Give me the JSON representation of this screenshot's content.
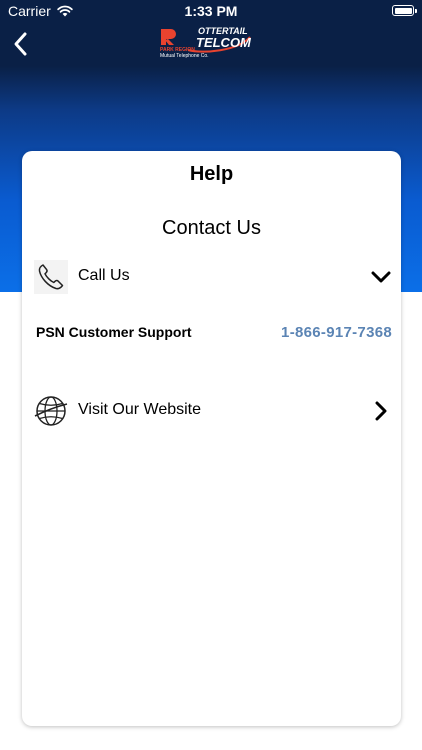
{
  "status_bar": {
    "carrier": "Carrier",
    "time": "1:33 PM"
  },
  "nav": {
    "back_icon": "chevron-left-icon",
    "logo": {
      "line1": "OTTERTAIL",
      "line2": "TELCOM",
      "line3": "PARK REGION",
      "line4": "Mutual Telephone Co."
    }
  },
  "card": {
    "title": "Help",
    "section_title": "Contact Us",
    "call_row": {
      "label": "Call Us",
      "icon": "phone-icon",
      "chevron": "chevron-down-icon"
    },
    "support": {
      "name": "PSN Customer Support",
      "phone": "1-866-917-7368"
    },
    "website_row": {
      "label": "Visit Our Website",
      "icon": "globe-icon",
      "chevron": "chevron-right-icon"
    }
  },
  "colors": {
    "header_dark": "#0a2046",
    "header_gradient_bottom": "#0b6fe8",
    "phone_link": "#5b84b4",
    "logo_red": "#e8432f"
  }
}
